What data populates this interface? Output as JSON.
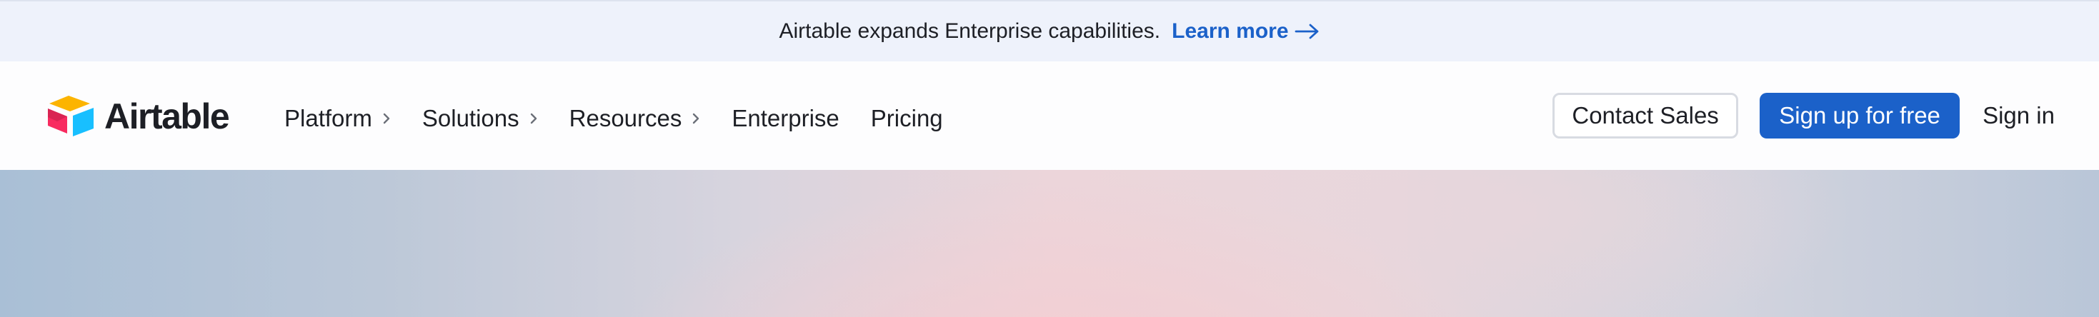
{
  "banner": {
    "message": "Airtable expands Enterprise capabilities.",
    "link_label": "Learn more",
    "link_icon": "arrow-right-icon"
  },
  "header": {
    "logo_text": "Airtable",
    "nav": [
      {
        "label": "Platform",
        "has_menu": true
      },
      {
        "label": "Solutions",
        "has_menu": true
      },
      {
        "label": "Resources",
        "has_menu": true
      },
      {
        "label": "Enterprise",
        "has_menu": false
      },
      {
        "label": "Pricing",
        "has_menu": false
      }
    ],
    "contact_label": "Contact Sales",
    "signup_label": "Sign up for free",
    "signin_label": "Sign in"
  },
  "colors": {
    "accent": "#1b61c9",
    "banner_bg": "#eef2fb",
    "text": "#1d1f25"
  }
}
